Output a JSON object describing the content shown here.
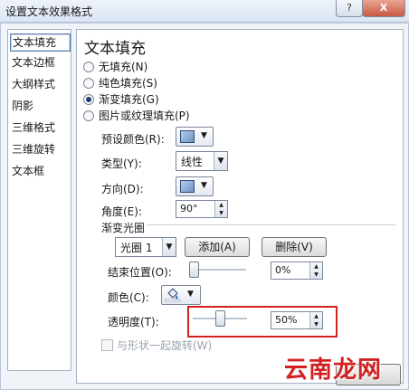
{
  "window": {
    "title": "设置文本效果格式",
    "help_label": "?",
    "close_label": "X"
  },
  "nav": {
    "items": [
      "文本填充",
      "文本边框",
      "大纲样式",
      "阴影",
      "三维格式",
      "三维旋转",
      "文本框"
    ],
    "selected": 0
  },
  "panel": {
    "heading": "文本填充",
    "fill_options": [
      {
        "label": "无填充(N)",
        "selected": false
      },
      {
        "label": "纯色填充(S)",
        "selected": false
      },
      {
        "label": "渐变填充(G)",
        "selected": true
      },
      {
        "label": "图片或纹理填充(P)",
        "selected": false
      }
    ],
    "preset_color_label": "预设颜色(R):",
    "type_label": "类型(Y):",
    "type_value": "线性",
    "direction_label": "方向(D):",
    "angle_label": "角度(E):",
    "angle_value": "90°",
    "gradient_stops_label": "渐变光圈",
    "stop_value": "光圈 1",
    "add_button": "添加(A)",
    "delete_button": "删除(V)",
    "end_position_label": "结束位置(O):",
    "end_position_value": "0%",
    "end_position_fraction": 0.0,
    "color_label": "颜色(C):",
    "transparency_label": "透明度(T):",
    "transparency_value": "50%",
    "transparency_fraction": 0.5,
    "rotate_with_shape_label": "与形状一起旋转(W)",
    "rotate_with_shape_checked": false
  },
  "watermark": "云南龙网",
  "colors": {
    "highlight_box": "#d62020",
    "watermark": "#d12121"
  }
}
